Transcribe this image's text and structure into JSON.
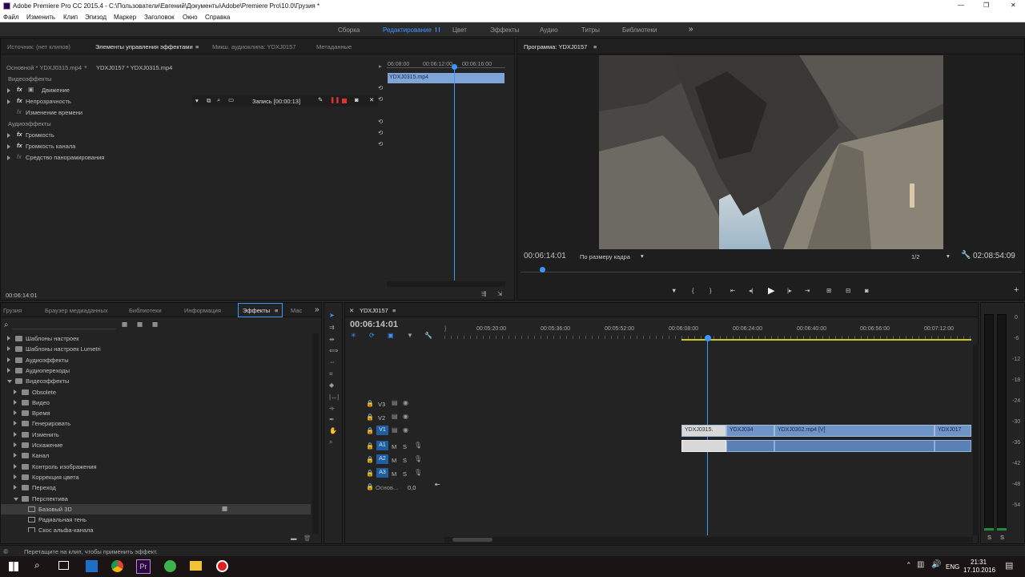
{
  "window": {
    "title": "Adobe Premiere Pro CC 2015.4 - C:\\Пользователи\\Евгений\\Документы\\Adobe\\Premiere Pro\\10.0\\Грузия *",
    "min": "—",
    "max": "❐",
    "close": "✕"
  },
  "menu": [
    "Файл",
    "Изменить",
    "Клип",
    "Эпизод",
    "Маркер",
    "Заголовок",
    "Окно",
    "Справка"
  ],
  "workspaces": {
    "items": [
      "Сборка",
      "Редактирование",
      "Цвет",
      "Эффекты",
      "Аудио",
      "Титры",
      "Библиотеки"
    ],
    "active": "Редактирование",
    "more": "»"
  },
  "source_panel": {
    "tabs": [
      "Источник: (нет клипов)",
      "Элементы управления эффектами",
      "Микш. аудиоклипа: YDXJ0157",
      "Метаданные"
    ],
    "master": "Основной * YDXJ0315.mp4",
    "sequence_clip": "YDXJ0157 * YDXJ0315.mp4",
    "times": [
      "06:08:00",
      "00:06:12:00",
      "00:06:16:00"
    ],
    "clip_bar": "YDXJ0315.mp4",
    "video_header": "Видеоэффекты",
    "video_items": [
      "Движение",
      "Непрозрачность",
      "Изменение времени"
    ],
    "record_label": "Запись [00:00:13]",
    "audio_header": "Аудиоэффекты",
    "audio_items": [
      "Громкость",
      "Громкость канала",
      "Средство панорамирования"
    ],
    "timecode": "00:06:14:01",
    "fx": "fx"
  },
  "program_panel": {
    "title": "Программа: YDXJ0157",
    "timecode": "00:06:14:01",
    "fit": "По размеру кадра",
    "resolution": "1/2",
    "duration": "02:08:54:09"
  },
  "effects_panel": {
    "tabs": [
      "Грузия",
      "Браузер медиаданных",
      "Библиотеки",
      "Информация",
      "Эффекты",
      "Мас"
    ],
    "tree": [
      {
        "label": "Шаблоны настроек",
        "level": 0,
        "open": false
      },
      {
        "label": "Шаблоны настроек Lumetri",
        "level": 0,
        "open": false
      },
      {
        "label": "Аудиоэффекты",
        "level": 0,
        "open": false
      },
      {
        "label": "Аудиопереходы",
        "level": 0,
        "open": false
      },
      {
        "label": "Видеоэффекты",
        "level": 0,
        "open": true
      },
      {
        "label": "Obsolete",
        "level": 1,
        "open": false
      },
      {
        "label": "Видео",
        "level": 1,
        "open": false
      },
      {
        "label": "Время",
        "level": 1,
        "open": false
      },
      {
        "label": "Генерировать",
        "level": 1,
        "open": false
      },
      {
        "label": "Изменить",
        "level": 1,
        "open": false
      },
      {
        "label": "Искажение",
        "level": 1,
        "open": false
      },
      {
        "label": "Канал",
        "level": 1,
        "open": false
      },
      {
        "label": "Контроль изображения",
        "level": 1,
        "open": false
      },
      {
        "label": "Коррекция цвета",
        "level": 1,
        "open": false
      },
      {
        "label": "Переход",
        "level": 1,
        "open": false
      },
      {
        "label": "Перспектива",
        "level": 1,
        "open": true
      },
      {
        "label": "Базовый 3D",
        "level": 2,
        "open": false
      },
      {
        "label": "Радиальная тень",
        "level": 2,
        "open": false
      },
      {
        "label": "Скос альфа-канала",
        "level": 2,
        "open": false
      }
    ]
  },
  "timeline": {
    "tab": "YDXJ0157",
    "timecode": "00:06:14:01",
    "ruler": [
      "00:05:20:00",
      "00:05:36:00",
      "00:05:52:00",
      "00:06:08:00",
      "00:06:24:00",
      "00:06:40:00",
      "00:06:56:00",
      "00:07:12:00"
    ],
    "video_tracks": [
      "V3",
      "V2",
      "V1"
    ],
    "audio_tracks": [
      "A1",
      "A2",
      "A3"
    ],
    "master_label": "Основ...",
    "master_value": "0,0",
    "clips": [
      "YDXJ0315.",
      "YDXJ034",
      "YDXJ0302.mp4 [V]",
      "YDXJ017"
    ],
    "m": "M",
    "s": "S"
  },
  "meter": {
    "labels": [
      "0",
      "-6",
      "-12",
      "-18",
      "-24",
      "-30",
      "-36",
      "-42",
      "-48",
      "-54"
    ],
    "solo": [
      "S",
      "S"
    ]
  },
  "status": {
    "text": "Перетащите на клип, чтобы применить эффект."
  },
  "taskbar": {
    "lang": "ENG",
    "time": "21:31",
    "date": "17.10.2016"
  }
}
